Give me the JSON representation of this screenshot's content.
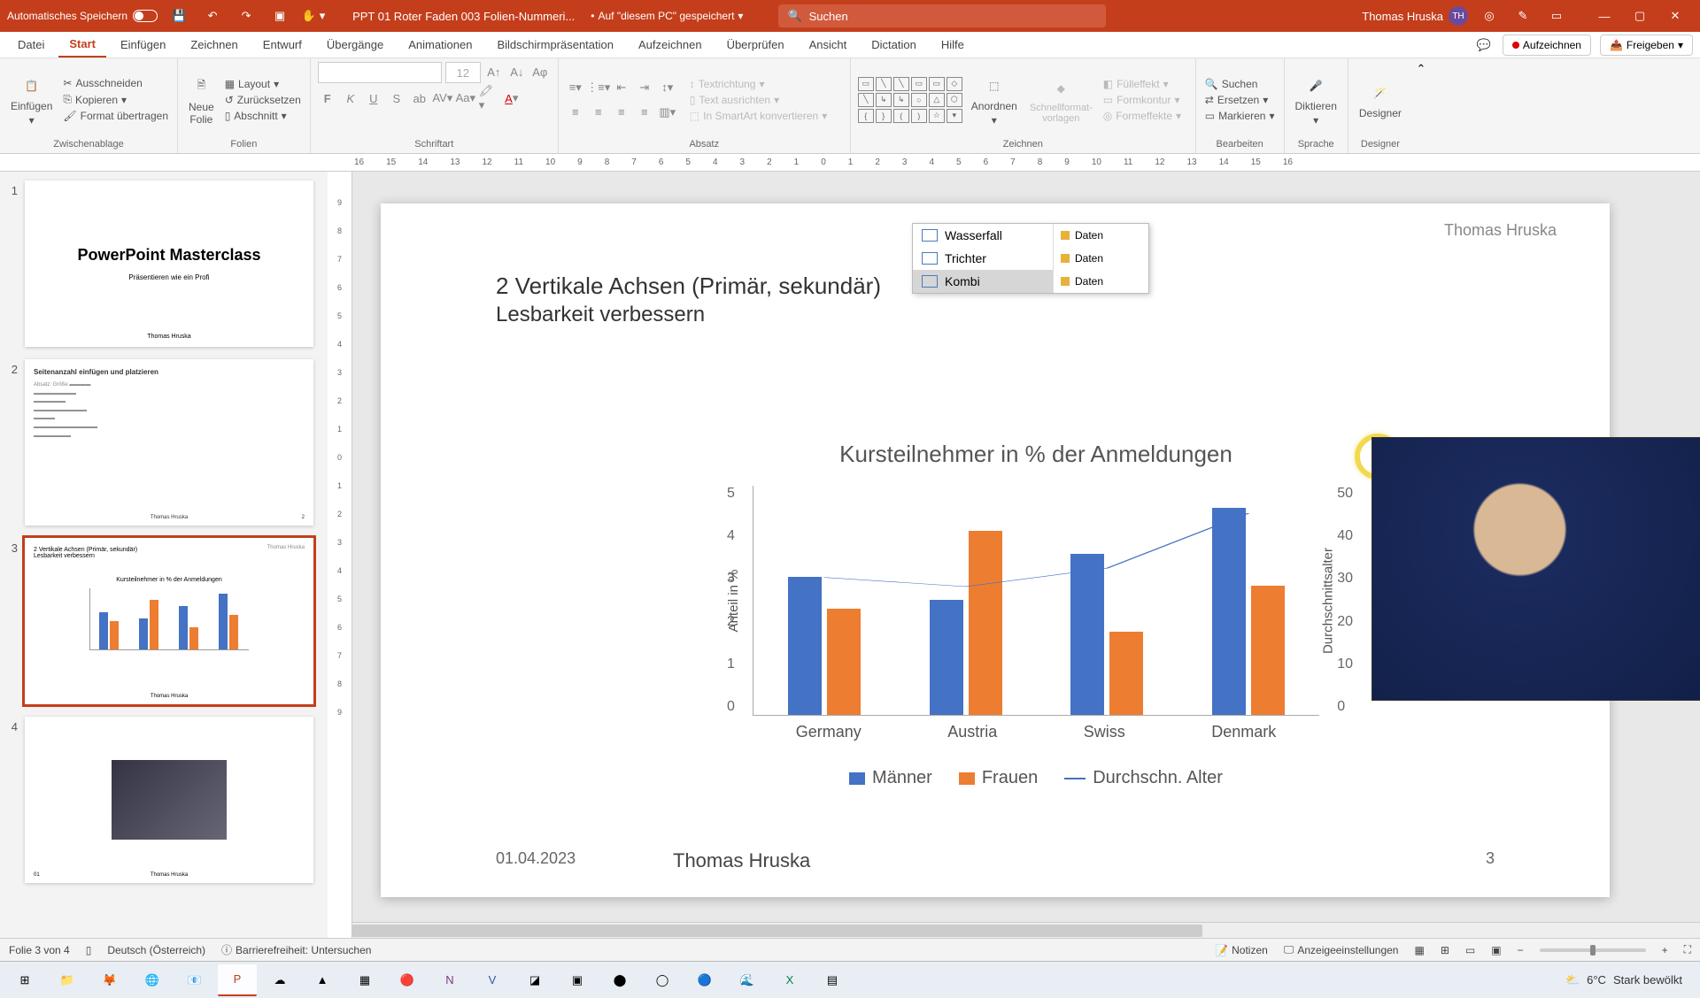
{
  "titlebar": {
    "autosave": "Automatisches Speichern",
    "filename": "PPT 01 Roter Faden 003 Folien-Nummeri...",
    "saved_location": "Auf \"diesem PC\" gespeichert",
    "search_placeholder": "Suchen",
    "user_name": "Thomas Hruska",
    "user_initials": "TH"
  },
  "tabs": {
    "datei": "Datei",
    "start": "Start",
    "einfuegen": "Einfügen",
    "zeichnen": "Zeichnen",
    "entwurf": "Entwurf",
    "uebergaenge": "Übergänge",
    "animationen": "Animationen",
    "bildschirm": "Bildschirmpräsentation",
    "aufzeichnen_tab": "Aufzeichnen",
    "ueberpruefen": "Überprüfen",
    "ansicht": "Ansicht",
    "dictation": "Dictation",
    "hilfe": "Hilfe",
    "aufzeichnen_btn": "Aufzeichnen",
    "freigeben": "Freigeben"
  },
  "ribbon": {
    "zwischenablage": {
      "label": "Zwischenablage",
      "einfuegen": "Einfügen",
      "ausschneiden": "Ausschneiden",
      "kopieren": "Kopieren",
      "format": "Format übertragen"
    },
    "folien": {
      "label": "Folien",
      "neue": "Neue\nFolie",
      "layout": "Layout",
      "zuruecksetzen": "Zurücksetzen",
      "abschnitt": "Abschnitt"
    },
    "schriftart": {
      "label": "Schriftart",
      "size": "12"
    },
    "absatz": {
      "label": "Absatz",
      "textrichtung": "Textrichtung",
      "textausrichten": "Text ausrichten",
      "smartart": "In SmartArt konvertieren"
    },
    "zeichnen": {
      "label": "Zeichnen",
      "anordnen": "Anordnen",
      "schnellformat": "Schnellformat-\nvorlagen",
      "fuelleffekt": "Fülleffekt",
      "formkontur": "Formkontur",
      "formeffekte": "Formeffekte"
    },
    "bearbeiten": {
      "label": "Bearbeiten",
      "suchen": "Suchen",
      "ersetzen": "Ersetzen",
      "markieren": "Markieren"
    },
    "sprache": {
      "label": "Sprache",
      "diktieren": "Diktieren"
    },
    "designer": {
      "label": "Designer",
      "designer": "Designer"
    }
  },
  "thumbs": {
    "t1_title": "PowerPoint Masterclass",
    "t1_sub": "Präsentieren wie ein Profi",
    "t1_author": "Thomas Hruska",
    "t2_title": "Seitenanzahl einfügen und platzieren",
    "t3_author": "Thomas Hruska",
    "t4_author": "Thomas Hruska"
  },
  "slide": {
    "author": "Thomas Hruska",
    "title": "2 Vertikale Achsen (Primär, sekundär)",
    "subtitle": "Lesbarkeit verbessern",
    "footer_date": "01.04.2023",
    "footer_name": "Thomas Hruska",
    "footer_page": "3",
    "panel": {
      "wasserfall": "Wasserfall",
      "trichter": "Trichter",
      "kombi": "Kombi",
      "daten": "Daten"
    }
  },
  "chart_data": {
    "type": "bar",
    "title": "Kursteilnehmer in % der Anmeldungen",
    "categories": [
      "Germany",
      "Austria",
      "Swiss",
      "Denmark"
    ],
    "series": [
      {
        "name": "Männer",
        "values": [
          3.0,
          2.5,
          3.5,
          4.5
        ]
      },
      {
        "name": "Frauen",
        "values": [
          2.3,
          4.0,
          1.8,
          2.8
        ]
      },
      {
        "name": "Durchschn. Alter",
        "values": [
          30,
          28,
          32,
          44
        ],
        "axis": "y2",
        "type": "line"
      }
    ],
    "ylabel": "Anteil in %",
    "y2label": "Durchschnittsalter",
    "ylim": [
      0,
      5
    ],
    "y2lim": [
      0,
      50
    ],
    "legend": [
      "Männer",
      "Frauen",
      "Durchschn. Alter"
    ]
  },
  "status": {
    "slide_count": "Folie 3 von 4",
    "language": "Deutsch (Österreich)",
    "accessibility": "Barrierefreiheit: Untersuchen",
    "notizen": "Notizen",
    "anzeige": "Anzeigeeinstellungen"
  },
  "taskbar": {
    "temp": "6°C",
    "weather": "Stark bewölkt"
  }
}
